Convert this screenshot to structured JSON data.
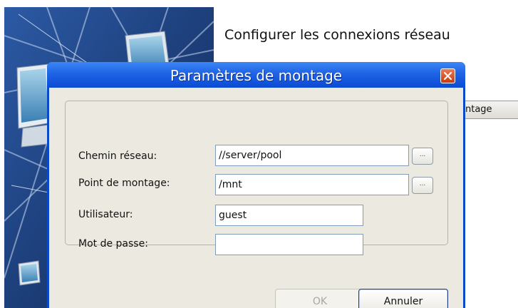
{
  "wizard": {
    "title": "Configurer les connexions réseau",
    "column_header_partial": "ntage"
  },
  "dialog": {
    "title": "Paramètres de montage",
    "close_icon": "close-icon",
    "fields": {
      "network_path": {
        "label": "Chemin réseau:",
        "value": "//server/pool",
        "browse_label": "..."
      },
      "mount_point": {
        "label": "Point de montage:",
        "value": "/mnt",
        "browse_label": "..."
      },
      "user": {
        "label": "Utilisateur:",
        "value": "guest"
      },
      "password": {
        "label": "Mot de passe:",
        "value": ""
      }
    },
    "buttons": {
      "ok": "OK",
      "cancel": "Annuler"
    }
  },
  "colors": {
    "titlebar": "#1f63e6",
    "client_bg": "#eceae0",
    "close_button": "#d9542b",
    "art_bg": "#1d3f7c"
  }
}
